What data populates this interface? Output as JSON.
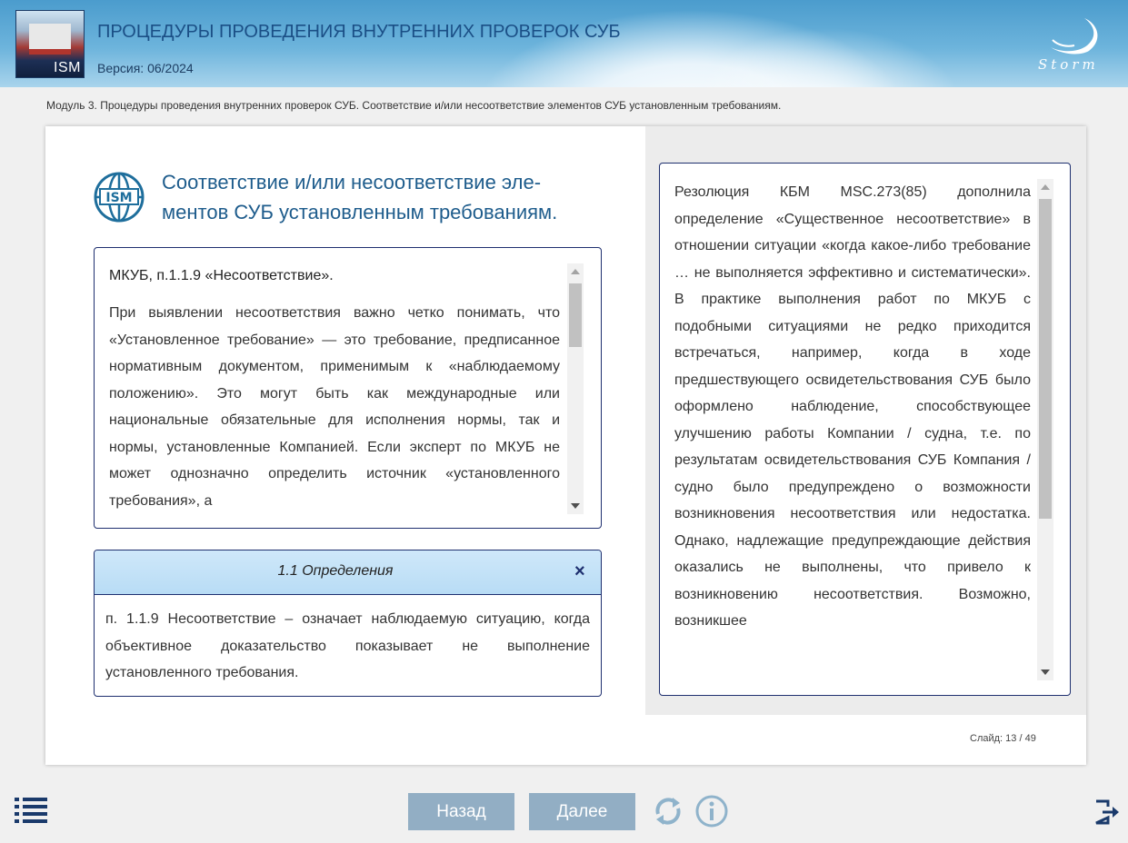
{
  "header": {
    "title": "ПРОЦЕДУРЫ ПРОВЕДЕНИЯ ВНУТРЕННИХ ПРОВЕРОК СУБ",
    "version": "Версия: 06/2024",
    "logo_label": "ISM",
    "brand": "Storm"
  },
  "breadcrumb": "Модуль 3. Процедуры проведения внутренних проверок СУБ. Соответствие и/или несоответствие элементов СУБ установленным требованиям.",
  "slide": {
    "title": "Соответствие и/или несоответствие эле-ментов СУБ установленным требованиям.",
    "ism_icon_label": "ISM",
    "box1": {
      "ref": "МКУБ, п.1.1.9 ",
      "quote_open": "«",
      "term": "Несоответствие",
      "quote_close": "».",
      "text": "При выявлении несоответствия важно четко понимать, что «Установленное требование» — это требование, предписанное нормативным документом, применимым к «наблюдаемому положению». Это могут быть как международные или национальные обязательные для исполнения нормы, так и нормы, установленные Компанией. Если эксперт по МКУБ не может однозначно определить источник «установленного требования», а"
    },
    "box2": {
      "tab_title": "1.1 Определения",
      "close_label": "×",
      "ref": "п. 1.1.9",
      "text": " Несоответствие – означает наблюдаемую ситуацию, когда объективное доказательство показывает не выполнение установленного требования."
    },
    "box3": {
      "text_before": "Резолюция КБМ MSC.273(85) дополнила определение «",
      "term": "Существенное несоответствие",
      "text_after": "» в отношении ситуации «когда какое-либо требование … не выполняется эффективно и систематически». В практике выполнения работ по МКУБ с подобными ситуациями не редко приходится встречаться, например, когда в ходе предшествующего освидетельствования СУБ было оформлено наблюдение, способствующее улучшению работы Компании / судна, т.е. по результатам освидетельствования СУБ Компания / судно было предупреждено о возможности возникновения несоответствия или недостатка. Однако, надлежащие предупреждающие действия оказались не выполнены, что привело к возникновению несоответствия. Возможно, возникшее"
    },
    "counter_label": "Слайд:",
    "counter_value": "13 / 49"
  },
  "toolbar": {
    "back_label": "Назад",
    "next_label": "Далее",
    "icons": [
      "menu-icon",
      "replay-icon",
      "info-icon",
      "exit-icon"
    ]
  },
  "colors": {
    "header_blue": "#4b9ccd",
    "title_blue": "#1e5c8c",
    "button": "#92aec4",
    "border": "#1e2f6f"
  }
}
